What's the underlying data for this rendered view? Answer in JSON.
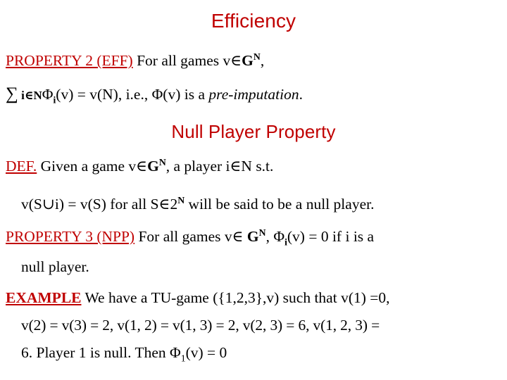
{
  "slide": {
    "background_color": "#FFFFFF",
    "accent_color": "#C00000",
    "text_color": "#000000"
  },
  "headings": {
    "efficiency": "Efficiency",
    "null_player_property": "Null Player Property"
  },
  "efficiency_section": {
    "property_tag": "PROPERTY 2 (EFF)",
    "property_text_after_tag": " For all games v∈",
    "property_set_symbol": "G",
    "property_set_superscript": "N",
    "property_text_end": ",",
    "formula_sigma": "∑",
    "formula_sum_index": "i∈N",
    "formula_phi": "Φ",
    "formula_phi_sub": "i",
    "formula_rest": "(v) = v(N), i.e., Φ(v) is a ",
    "formula_italic": "pre-imputation",
    "formula_period": "."
  },
  "null_player_section": {
    "def_tag": "DEF.",
    "def_text_1": " Given a game v∈",
    "def_set_symbol": "G",
    "def_set_superscript": "N",
    "def_text_2": ", a player i∈N s.t.",
    "def_line2_part1": "v(S∪i) = v(S) for all S∈2",
    "def_line2_superscript": "N",
    "def_line2_part2": " will be said to be a null player.",
    "property3_tag": "PROPERTY 3 (NPP)",
    "property3_text_1": " For all games v∈ ",
    "property3_set_symbol": "G",
    "property3_set_superscript": "N",
    "property3_text_2": ", Φ",
    "property3_phi_sub": "i",
    "property3_text_3": "(v) = 0 if i is a",
    "property3_line2": "null player."
  },
  "example_section": {
    "example_tag": "EXAMPLE",
    "line1": " We have a TU-game ({1,2,3},v) such that v(1) =0,",
    "line2": "v(2) = v(3) = 2, v(1, 2) = v(1, 3) = 2, v(2, 3) = 6, v(1, 2, 3) =",
    "line3_part1": "6. Player 1 is null. Then Φ",
    "line3_sub": "1",
    "line3_part2": "(v) = 0"
  }
}
